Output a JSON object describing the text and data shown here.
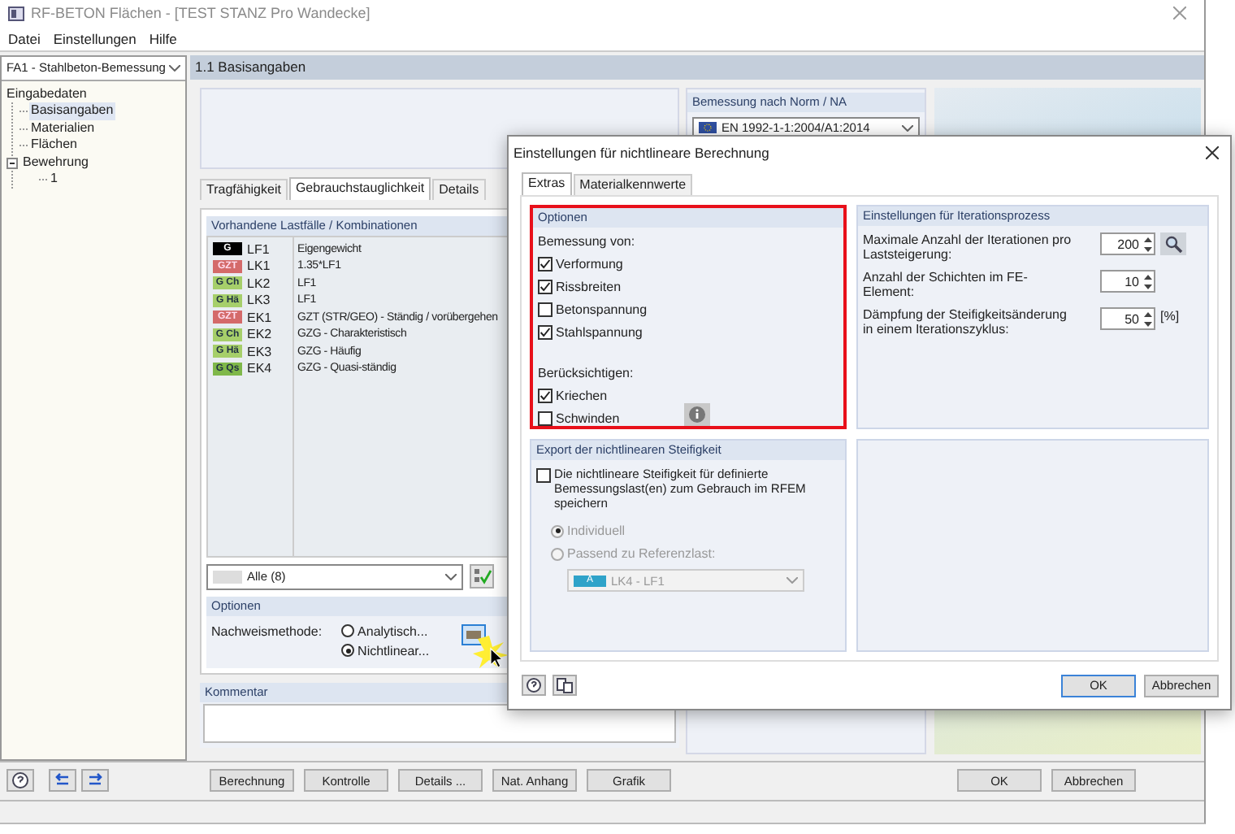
{
  "window": {
    "title": "RF-BETON Flächen - [TEST STANZ Pro Wandecke]"
  },
  "menu": [
    "Datei",
    "Einstellungen",
    "Hilfe"
  ],
  "case_selector": {
    "value": "FA1 - Stahlbeton-Bemessung"
  },
  "tree": [
    {
      "label": "Eingabedaten",
      "selected": false,
      "children": [
        {
          "label": "Basisangaben",
          "selected": true
        },
        {
          "label": "Materialien",
          "selected": false
        },
        {
          "label": "Flächen",
          "selected": false
        },
        {
          "label": "Bewehrung",
          "selected": false,
          "expanded": true,
          "children": [
            {
              "label": "1",
              "selected": false
            }
          ]
        }
      ]
    }
  ],
  "section_title": "1.1 Basisangaben",
  "norm": {
    "label": "Bemessung nach Norm / NA",
    "value": "EN 1992-1-1:2004/A1:2014"
  },
  "tabs": [
    {
      "label": "Tragfähigkeit",
      "selected": false
    },
    {
      "label": "Gebrauchstauglichkeit",
      "selected": true
    },
    {
      "label": "Details",
      "selected": false
    }
  ],
  "load_list": {
    "title": "Vorhandene Lastfälle / Kombinationen",
    "rows": [
      {
        "tag": "G",
        "color": "#000000",
        "id": "LF1",
        "description": "Eigengewicht"
      },
      {
        "tag": "GZT",
        "color": "#d46a6a",
        "id": "LK1",
        "description": "1.35*LF1"
      },
      {
        "tag": "G Ch",
        "color": "#a6cf6a",
        "id": "LK2",
        "description": "LF1"
      },
      {
        "tag": "G Hä",
        "color": "#a6cf6a",
        "id": "LK3",
        "description": "LF1"
      },
      {
        "tag": "GZT",
        "color": "#d46a6a",
        "id": "EK1",
        "description": "GZT (STR/GEO) - Ständig / vorübergehen"
      },
      {
        "tag": "G Ch",
        "color": "#a6cf6a",
        "id": "EK2",
        "description": "GZG - Charakteristisch"
      },
      {
        "tag": "G Hä",
        "color": "#a6cf6a",
        "id": "EK3",
        "description": "GZG - Häufig"
      },
      {
        "tag": "G Qs",
        "color": "#7fb84a",
        "id": "EK4",
        "description": "GZG - Quasi-ständig"
      }
    ]
  },
  "filter": {
    "value": "Alle (8)"
  },
  "options": {
    "title": "Optionen",
    "label": "Nachweismethode:",
    "methods": [
      {
        "label": "Analytisch...",
        "selected": false
      },
      {
        "label": "Nichtlinear...",
        "selected": true
      }
    ]
  },
  "comment": {
    "title": "Kommentar"
  },
  "bottom_buttons": [
    "Berechnung",
    "Kontrolle",
    "Details ...",
    "Nat. Anhang",
    "Grafik"
  ],
  "actions": [
    "OK",
    "Abbrechen"
  ],
  "dialog": {
    "title": "Einstellungen für nichtlineare Berechnung",
    "tabs": [
      {
        "label": "Extras",
        "selected": true
      },
      {
        "label": "Materialkennwerte",
        "selected": false
      }
    ],
    "options": {
      "title": "Optionen",
      "design_label": "Bemessung von:",
      "design_checks": [
        {
          "label": "Verformung",
          "checked": true
        },
        {
          "label": "Rissbreiten",
          "checked": true
        },
        {
          "label": "Betonspannung",
          "checked": false
        },
        {
          "label": "Stahlspannung",
          "checked": true
        }
      ],
      "consider_label": "Berücksichtigen:",
      "consider": [
        {
          "label": "Kriechen",
          "checked": true
        },
        {
          "label": "Schwinden",
          "checked": false
        }
      ]
    },
    "iteration": {
      "title": "Einstellungen für Iterationsprozess",
      "settings": [
        {
          "kind": "tool",
          "label": "Maximale Anzahl der Iterationen pro Laststeigerung:",
          "value": "200"
        },
        {
          "kind": "plain",
          "label": "Anzahl der Schichten im FE-Element:",
          "value": "10"
        },
        {
          "kind": "unit",
          "label": "Dämpfung der Steifigkeitsänderung in einem Iterationszyklus:",
          "value": "50",
          "unit": "[%]"
        }
      ]
    },
    "export": {
      "title": "Export der nichtlinearen Steifigkeit",
      "checkbox": {
        "label": "Die nichtlineare Steifigkeit für definierte Bemessungslast(en) zum Gebrauch im RFEM speichern",
        "checked": false
      },
      "disabled": true,
      "modes": [
        {
          "label": "Individuell",
          "selected": true
        },
        {
          "label": "Passend zu Referenzlast:",
          "selected": false
        }
      ],
      "reference": {
        "tag": "A",
        "value": "LK4 - LF1"
      }
    },
    "buttons": [
      "OK",
      "Abbrechen"
    ]
  }
}
